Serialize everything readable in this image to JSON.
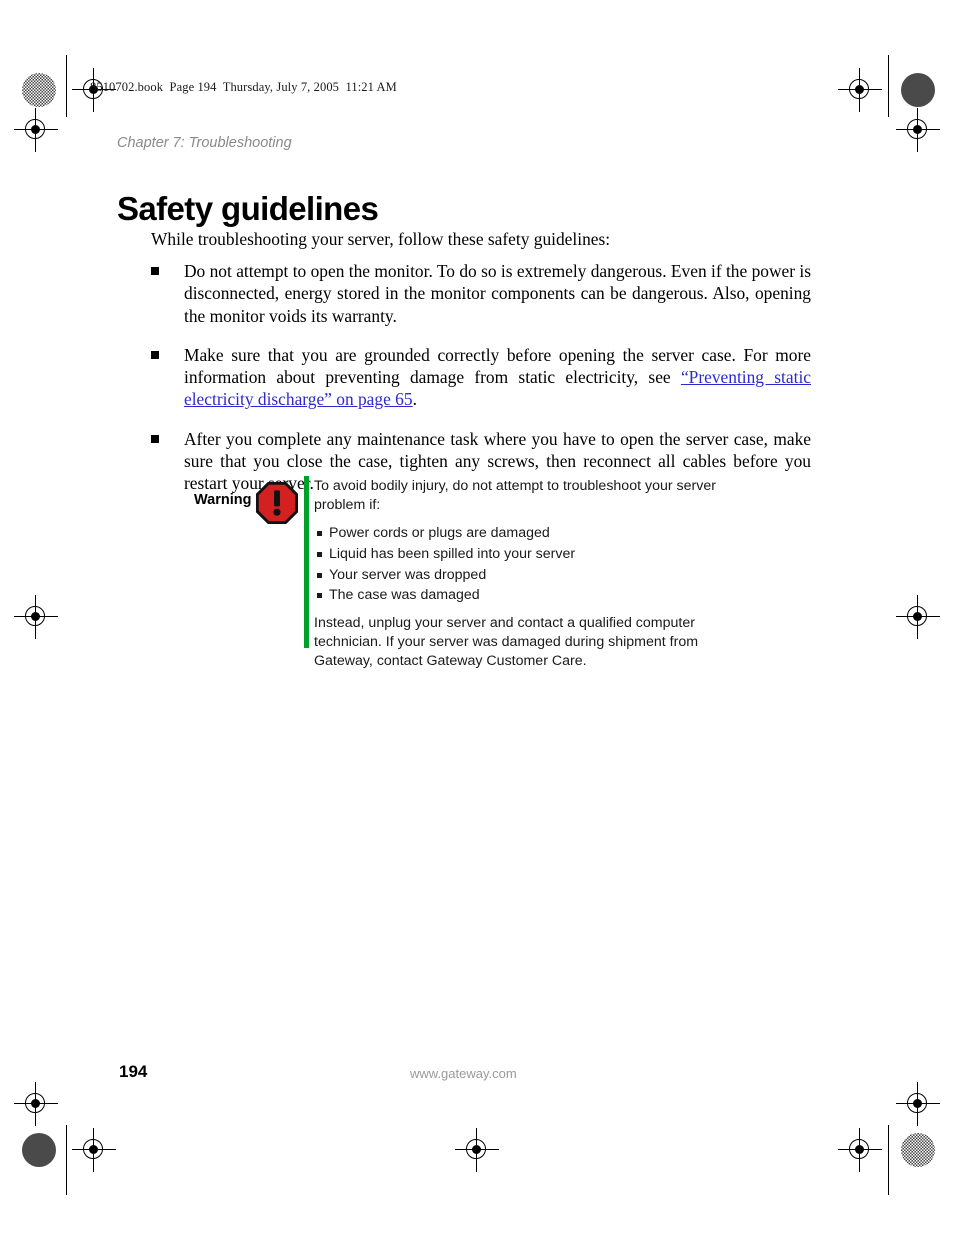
{
  "document": {
    "file_info": "8510702.book  Page 194  Thursday, July 7, 2005  11:21 AM",
    "chapter_label": "Chapter 7: Troubleshooting",
    "title": "Safety guidelines",
    "intro": "While troubleshooting your server, follow these safety guidelines:"
  },
  "bullets": [
    {
      "text": "Do not attempt to open the monitor. To do so is extremely dangerous. Even if the power is disconnected, energy stored in the monitor components can be dangerous. Also, opening the monitor voids its warranty."
    },
    {
      "text_before": "Make sure that you are grounded correctly before opening the server case. For more information about preventing damage from static electricity, see ",
      "link_text": "“Preventing static electricity discharge” on page 65",
      "text_after": "."
    },
    {
      "text": "After you complete any maintenance task where you have to open the server case, make sure that you close the case, tighten any screws, then reconnect all cables before you restart your server."
    }
  ],
  "warning": {
    "label": "Warning",
    "icon": "warning-octagon-exclamation-icon",
    "icon_color": "#d32020",
    "accent_bar_color": "#00a02c",
    "intro": "To avoid bodily injury, do not attempt to troubleshoot your server problem if:",
    "items": [
      "Power cords or plugs are damaged",
      "Liquid has been spilled into your server",
      "Your server was dropped",
      "The case was damaged"
    ],
    "outro": "Instead, unplug your server and contact a qualified computer technician. If your server was damaged during shipment from Gateway, contact Gateway Customer Care."
  },
  "footer": {
    "page_number": "194",
    "url": "www.gateway.com"
  },
  "print_marks": {
    "registration_icon": "registration-target-icon",
    "halftone_patch": "halftone-color-patch",
    "solid_patch": "solid-ink-patch"
  }
}
